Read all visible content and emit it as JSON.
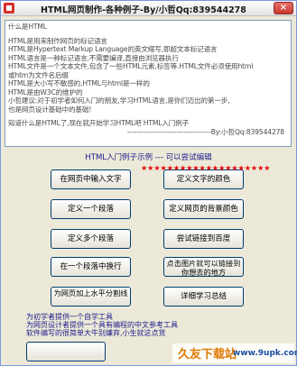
{
  "window": {
    "title": "HTML网页制作-各种例子-By/小哲Qq:839544278",
    "close_label": "×"
  },
  "textarea": {
    "lines": [
      "什么是HTML",
      "",
      "HTML是用来制作网页的标记语言",
      "HTML是Hypertext Markup Language的英文缩写,即超文本标记语言",
      "HTML语言是一种标记语言,不需要编译,直接由浏览器执行",
      "HTML文件是一个文本文件,包含了一些HTML元素,标签等.HTML文件必须使用html",
      "或htm为文件名后缀",
      "HTML是大小写不敏感的,HTML与html是一样的",
      "HTML是由W3C的维护的",
      "小哲建议:对于初学者如何入门的朋友,学习HTML语言,是你们迈出的第一步,",
      "也是网页设计基础中的基础!",
      "",
      "知道什么是HTML了,现在就开始学习HTML吧 HTML入门例子"
    ],
    "signature": "------------------------------------By:小哲Qq:839544278"
  },
  "section_label": "HTML入门例子示例 --- 可以尝试编辑",
  "buttons": {
    "input_text": "在网页中输入文字",
    "text_color": "定义文字的颜色",
    "one_paragraph": "定义一个段落",
    "bg_color": "定义网页的背景颜色",
    "multi_paragraph": "定义多个段落",
    "link_baidu": "尝试链接到百度",
    "line_break": "在一个段落中换行",
    "image_link": "点击图片就可以链接到你想去的地方",
    "hr_divider": "为网页加上水平分割线",
    "summary": "详细学习总结"
  },
  "stars": "★★★★★★★★★★★★★★★★★★★★",
  "footer": {
    "lines": [
      "为初学者提供一个自学工具",
      "为网页设计者提供一个具有编程的中文参考工具",
      "软件编写的很简单大牛别嫌弃,小生就这点货"
    ]
  },
  "watermark": {
    "brand": "久友下载站",
    "url": "www.9upk.com"
  }
}
